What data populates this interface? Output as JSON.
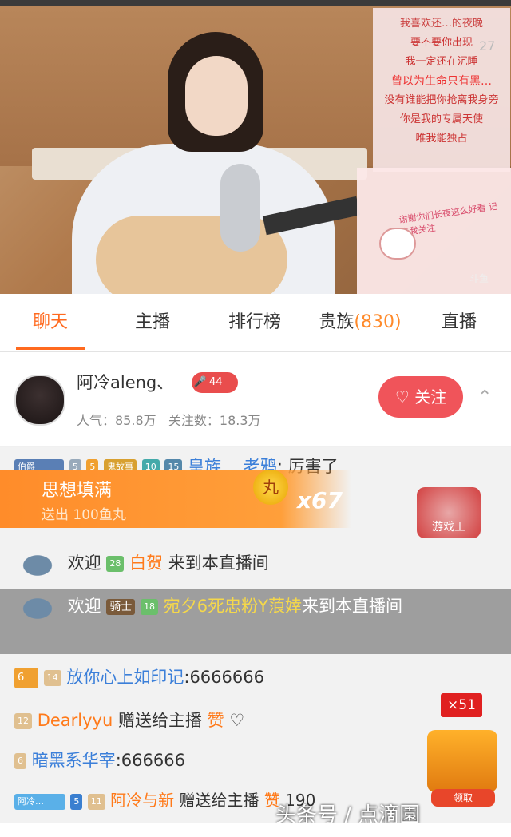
{
  "video": {
    "lyrics": [
      "我喜欢还…的夜晚",
      "要不要你出现",
      "我一定还在沉睡",
      "曾以为生命只有黑…",
      "没有谁能把你抢离我身旁",
      "你是我的专属天使",
      "唯我能独占"
    ],
    "lyric_time": "27",
    "note_text": "谢谢你们长夜这么好看 记点我关注",
    "watermark": "斗鱼"
  },
  "tabs": [
    {
      "label": "聊天",
      "active": true
    },
    {
      "label": "主播",
      "active": false
    },
    {
      "label": "排行榜",
      "active": false
    },
    {
      "label": "贵族",
      "count": "(830)",
      "active": false
    },
    {
      "label": "直播",
      "active": false
    }
  ],
  "host": {
    "name": "阿冷aleng、",
    "level": "44",
    "popularity": "人气：85.8万",
    "followers": "关注数：18.3万",
    "follow_label": "关注",
    "collapse_icon": "chevron-up-icon"
  },
  "chat": {
    "row1": {
      "badge": "伯爵",
      "lv1": "5",
      "lv2": "5",
      "fan": "鬼故事",
      "fan_lv": "10",
      "lv3": "15",
      "user": "皇族 …老鸦",
      "msg": ": 厉害了"
    },
    "gift_banner": {
      "title": "思想填满",
      "sub": "送出 100鱼丸",
      "coin": "丸",
      "mult": "x67"
    },
    "game_logo": "游戏王",
    "row3": {
      "prefix": "欢迎",
      "lv": "28",
      "user": "白贺",
      "suffix": "来到本直播间"
    },
    "row4": {
      "prefix": "欢迎",
      "title": "骑士",
      "lv": "18",
      "user": "宛夕6死忠粉Y蒗婞",
      "suffix": "来到本直播间"
    },
    "row5": {
      "lv": "6",
      "fan_lv": "14",
      "user": "放你心上如印记",
      "msg": ":6666666"
    },
    "row6": {
      "fan_lv": "12",
      "user": "Dearlyyu",
      "msg": "赠送给主播",
      "gift": "赞"
    },
    "row7": {
      "fan_lv": "6",
      "user": "暗黑系华宰",
      "msg": ":666666"
    },
    "row8": {
      "fan": "阿冷…",
      "lv": "5",
      "fan_lv": "11",
      "user": "阿冷与新",
      "msg": "赠送给主播",
      "gift": "赞",
      "tail": "190"
    },
    "redeem": {
      "count": "×51",
      "label": "领取"
    }
  },
  "watermark_bottom": "头条号 / 点滴園",
  "colors": {
    "accent": "#ff6a1f",
    "follow": "#f0545a",
    "banner": "#ff8c2a",
    "blue_nick": "#3b7fd9"
  }
}
